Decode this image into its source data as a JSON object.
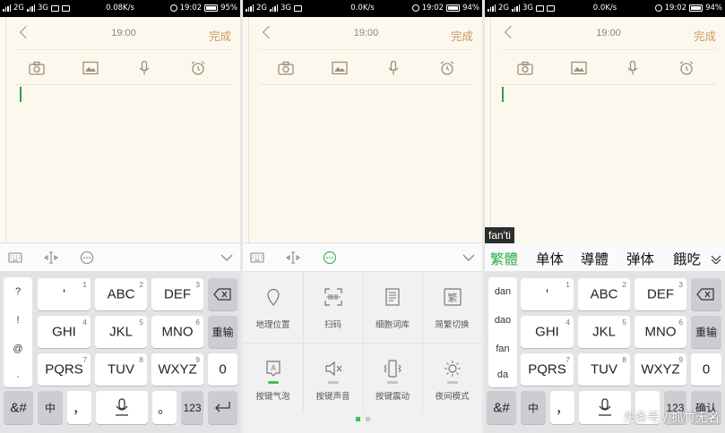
{
  "panels": [
    {
      "status": {
        "carrier1": "2G",
        "carrier2": "3G",
        "speed": "0.08K/s",
        "time": "19:02",
        "battery": "95%"
      },
      "header": {
        "time": "19:00",
        "done": "完成"
      }
    },
    {
      "status": {
        "carrier1": "2G",
        "carrier2": "3G",
        "speed": "0.0K/s",
        "time": "19:02",
        "battery": "94%"
      },
      "header": {
        "time": "19:00",
        "done": "完成"
      }
    },
    {
      "status": {
        "carrier1": "2G",
        "carrier2": "3G",
        "speed": "0.0K/s",
        "time": "19:02",
        "battery": "94%"
      },
      "header": {
        "time": "19:00",
        "done": "完成"
      }
    }
  ],
  "toolbar_icons": [
    "camera-icon",
    "image-icon",
    "microphone-icon",
    "alarm-icon"
  ],
  "keyboard": {
    "symbols": [
      "?",
      "!",
      "@",
      "."
    ],
    "keys": {
      "apostrophe": {
        "label": "'",
        "num": "1"
      },
      "abc": {
        "label": "ABC",
        "num": "2"
      },
      "def": {
        "label": "DEF",
        "num": "3"
      },
      "ghi": {
        "label": "GHI",
        "num": "4"
      },
      "jkl": {
        "label": "JKL",
        "num": "5"
      },
      "mno": {
        "label": "MNO",
        "num": "6"
      },
      "pqrs": {
        "label": "PQRS",
        "num": "7"
      },
      "tuv": {
        "label": "TUV",
        "num": "8"
      },
      "wxyz": {
        "label": "WXYZ",
        "num": "9"
      }
    },
    "reenter": "重输",
    "zero": "0",
    "symbol_key": "&#",
    "zh": "中",
    "comma": "，",
    "period": "。",
    "num123": "123",
    "confirm": "确认"
  },
  "settings": {
    "items": [
      {
        "label": "地理位置",
        "icon": "location-pin-icon"
      },
      {
        "label": "扫码",
        "icon": "scan-code-icon"
      },
      {
        "label": "细胞词库",
        "icon": "cell-dictionary-icon"
      },
      {
        "label": "简繁切换",
        "icon": "traditional-simplified-icon"
      },
      {
        "label": "按键气泡",
        "icon": "key-bubble-icon",
        "on": true
      },
      {
        "label": "按键声音",
        "icon": "key-sound-icon",
        "on": false
      },
      {
        "label": "按键震动",
        "icon": "key-vibrate-icon",
        "on": false
      },
      {
        "label": "夜间模式",
        "icon": "night-mode-icon",
        "on": false
      }
    ],
    "page_count": 2,
    "current_page": 1
  },
  "candidates": {
    "pinyin": "fan'ti",
    "words": [
      "繁體",
      "单体",
      "導體",
      "弹体",
      "餓吃"
    ],
    "pinyin_options": [
      "dan",
      "dao",
      "fan",
      "da"
    ]
  },
  "watermark": "头条号 / 抓竹无名",
  "colors": {
    "accent": "#3dbd5a",
    "done": "#c79a5e",
    "paper": "#fdf8ee"
  }
}
